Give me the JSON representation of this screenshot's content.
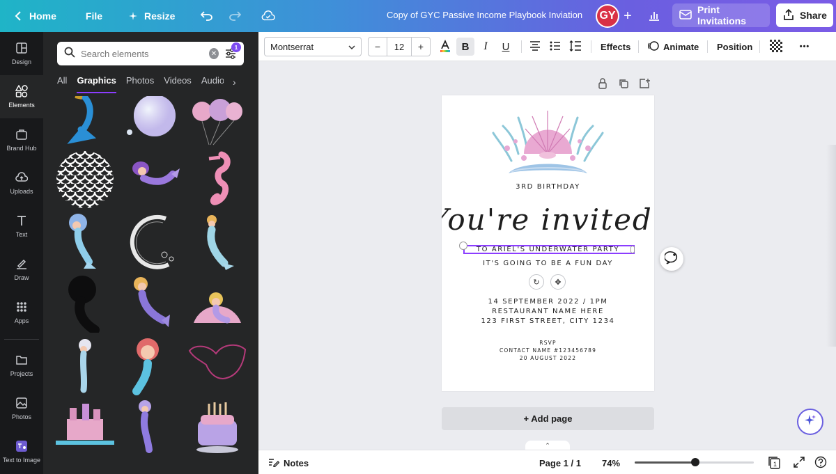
{
  "topbar": {
    "home": "Home",
    "file": "File",
    "resize": "Resize",
    "doc_title": "Copy of GYC Passive Income Playbook Inviation",
    "avatar_initials": "GY",
    "print": "Print Invitations",
    "share": "Share"
  },
  "rail": {
    "items": [
      {
        "label": "Design",
        "icon": "layout-icon"
      },
      {
        "label": "Elements",
        "icon": "shapes-icon"
      },
      {
        "label": "Brand Hub",
        "icon": "brand-icon"
      },
      {
        "label": "Uploads",
        "icon": "cloud-upload-icon"
      },
      {
        "label": "Text",
        "icon": "text-icon"
      },
      {
        "label": "Draw",
        "icon": "pen-icon"
      },
      {
        "label": "Apps",
        "icon": "apps-grid-icon"
      },
      {
        "label": "Projects",
        "icon": "folder-icon"
      },
      {
        "label": "Photos",
        "icon": "image-icon"
      },
      {
        "label": "Text to Image",
        "icon": "text-to-image-icon"
      }
    ]
  },
  "panel": {
    "search_placeholder": "Search elements",
    "filter_badge": "1",
    "tabs": [
      "All",
      "Graphics",
      "Photos",
      "Videos",
      "Audio"
    ],
    "active_tab": "Graphics"
  },
  "toolbar": {
    "font": "Montserrat",
    "size": "12",
    "minus": "−",
    "plus": "+",
    "bold": "B",
    "italic": "I",
    "underline": "U",
    "effects": "Effects",
    "animate": "Animate",
    "position": "Position",
    "more": "•••"
  },
  "invitation": {
    "line1": "3RD BIRTHDAY",
    "script": "You're invited!",
    "line2": "TO ARIEL'S UNDERWATER PARTY",
    "line3": "IT'S GOING TO BE A FUN DAY",
    "date": "14 SEPTEMBER 2022 / 1PM",
    "venue": "RESTAURANT NAME HERE",
    "address": "123 FIRST STREET, CITY 1234",
    "rsvp": "RSVP",
    "contact": "CONTACT NAME #123456789",
    "rsvp_date": "20 AUGUST 2022"
  },
  "canvas": {
    "add_page": "+ Add page"
  },
  "bottombar": {
    "notes": "Notes",
    "page": "Page 1 / 1",
    "zoom": "74%",
    "zoom_level": 0.51,
    "pages_count": "1"
  },
  "colors": {
    "accent": "#8b3dff",
    "avatar": "#d93145",
    "rail_bg": "#18191b",
    "panel_bg": "#252627"
  }
}
